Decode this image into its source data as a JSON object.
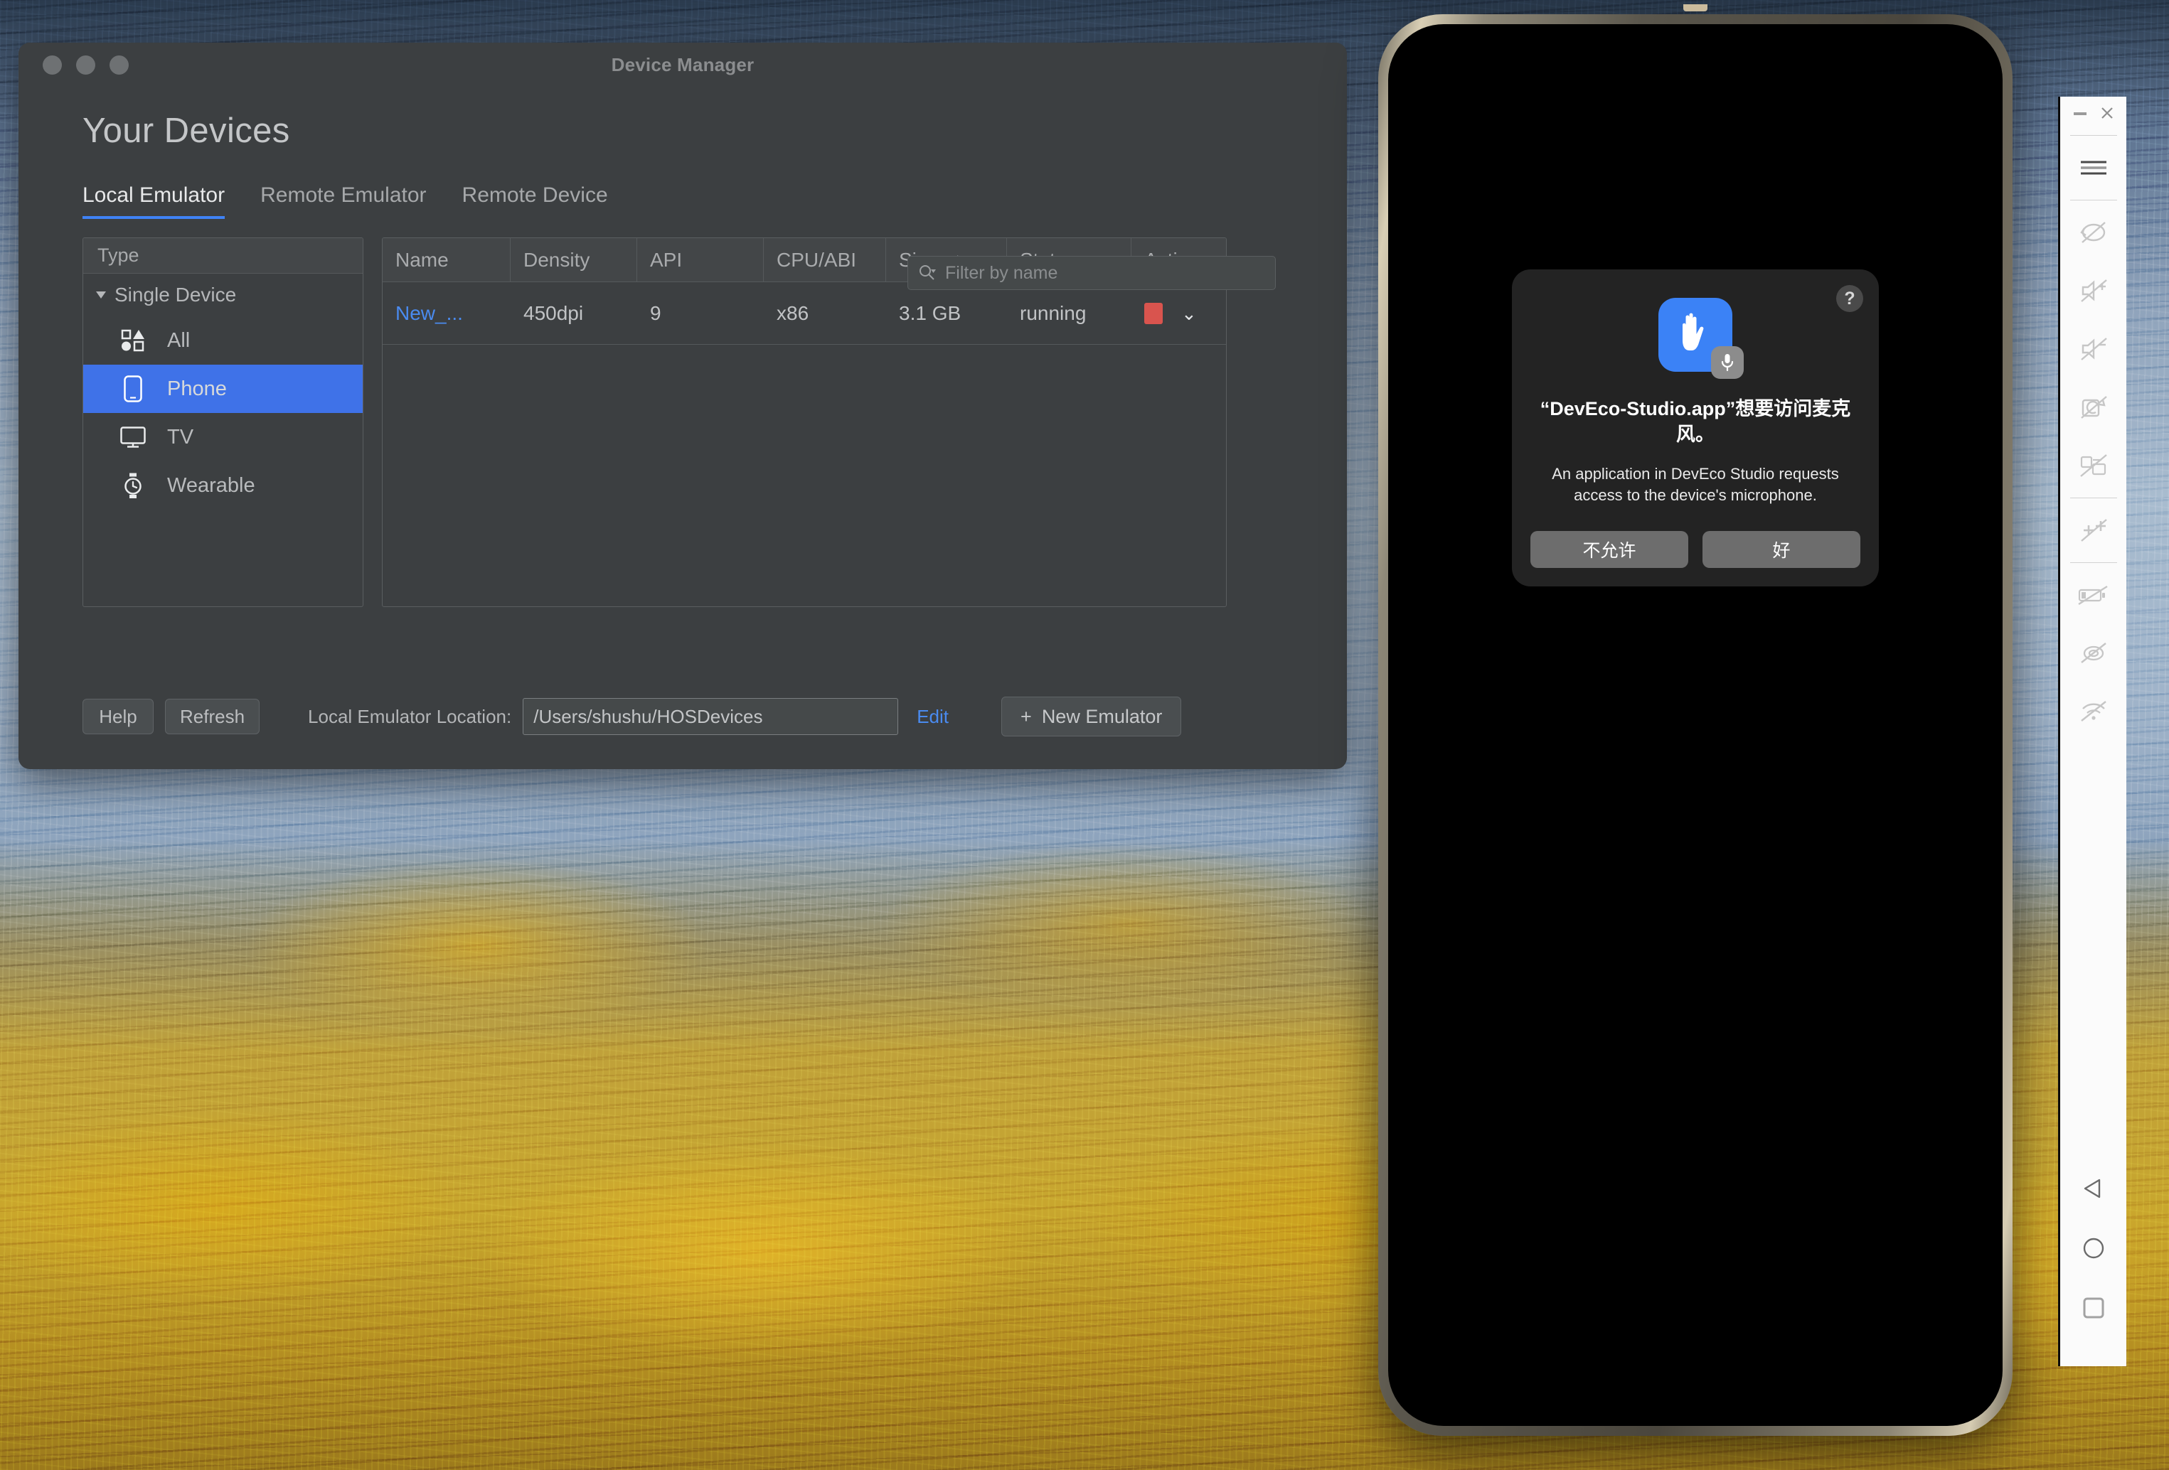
{
  "desktop": {
    "wallpaper_description": "snowy-forest-golden-larch"
  },
  "device_manager": {
    "window_title": "Device Manager",
    "page_title": "Your Devices",
    "traffic_lights": [
      "close",
      "minimize",
      "zoom"
    ],
    "tabs": [
      {
        "label": "Local Emulator",
        "active": true
      },
      {
        "label": "Remote Emulator",
        "active": false
      },
      {
        "label": "Remote Device",
        "active": false
      }
    ],
    "filter": {
      "placeholder": "Filter by name",
      "value": "",
      "icon": "search-icon"
    },
    "type_panel": {
      "header": "Type",
      "group_label": "Single Device",
      "items": [
        {
          "label": "All",
          "icon": "shapes-icon",
          "selected": false
        },
        {
          "label": "Phone",
          "icon": "phone-icon",
          "selected": true
        },
        {
          "label": "TV",
          "icon": "tv-icon",
          "selected": false
        },
        {
          "label": "Wearable",
          "icon": "watch-icon",
          "selected": false
        }
      ]
    },
    "table": {
      "columns": [
        "Name",
        "Density",
        "API",
        "CPU/ABI",
        "Siz...",
        "Status",
        "Actions"
      ],
      "sorted_column": "Siz...",
      "sort_direction": "ascending",
      "sort_arrow_glyph": "↑",
      "rows": [
        {
          "name": "New_...",
          "density": "450dpi",
          "api": "9",
          "cpu_abi": "x86",
          "size": "3.1 GB",
          "status": "running",
          "action_stop_color": "#d9544e",
          "action_menu_glyph": "⌄"
        }
      ]
    },
    "bottom_bar": {
      "help_label": "Help",
      "refresh_label": "Refresh",
      "location_label": "Local Emulator Location:",
      "location_value": "/Users/shushu/HOSDevices",
      "edit_label": "Edit",
      "new_emulator_label": "New Emulator",
      "new_emulator_plus": "+"
    },
    "accent_color": "#3f82f5",
    "link_color": "#4a8bf0"
  },
  "emulator": {
    "window_controls": {
      "minimize": "—",
      "close": "✕"
    },
    "menu_icon": "hamburger-menu-icon",
    "toolbar_buttons": [
      {
        "name": "rotate-left-icon",
        "disabled": true
      },
      {
        "name": "volume-up-icon",
        "disabled": true
      },
      {
        "name": "volume-down-icon",
        "disabled": true
      },
      {
        "name": "rotate-right-icon",
        "disabled": true
      },
      {
        "name": "screenshot-icon",
        "disabled": true
      },
      {
        "name": "zoom-in-icon",
        "disabled": true
      },
      {
        "name": "battery-icon",
        "disabled": true
      },
      {
        "name": "location-icon",
        "disabled": true
      },
      {
        "name": "network-icon",
        "disabled": true
      }
    ],
    "nav_buttons": [
      {
        "name": "back-button",
        "glyph": "triangle-left"
      },
      {
        "name": "home-button",
        "glyph": "circle"
      },
      {
        "name": "recents-button",
        "glyph": "square"
      }
    ],
    "permission_dialog": {
      "help_badge": "?",
      "app_icon": "privacy-hand-icon",
      "badge_icon": "microphone-icon",
      "title": "“DevEco-Studio.app”想要访问麦克风。",
      "description": "An application in DevEco Studio requests access to the device's microphone.",
      "deny_label": "不允许",
      "allow_label": "好",
      "accent_color": "#3b82f6"
    }
  }
}
